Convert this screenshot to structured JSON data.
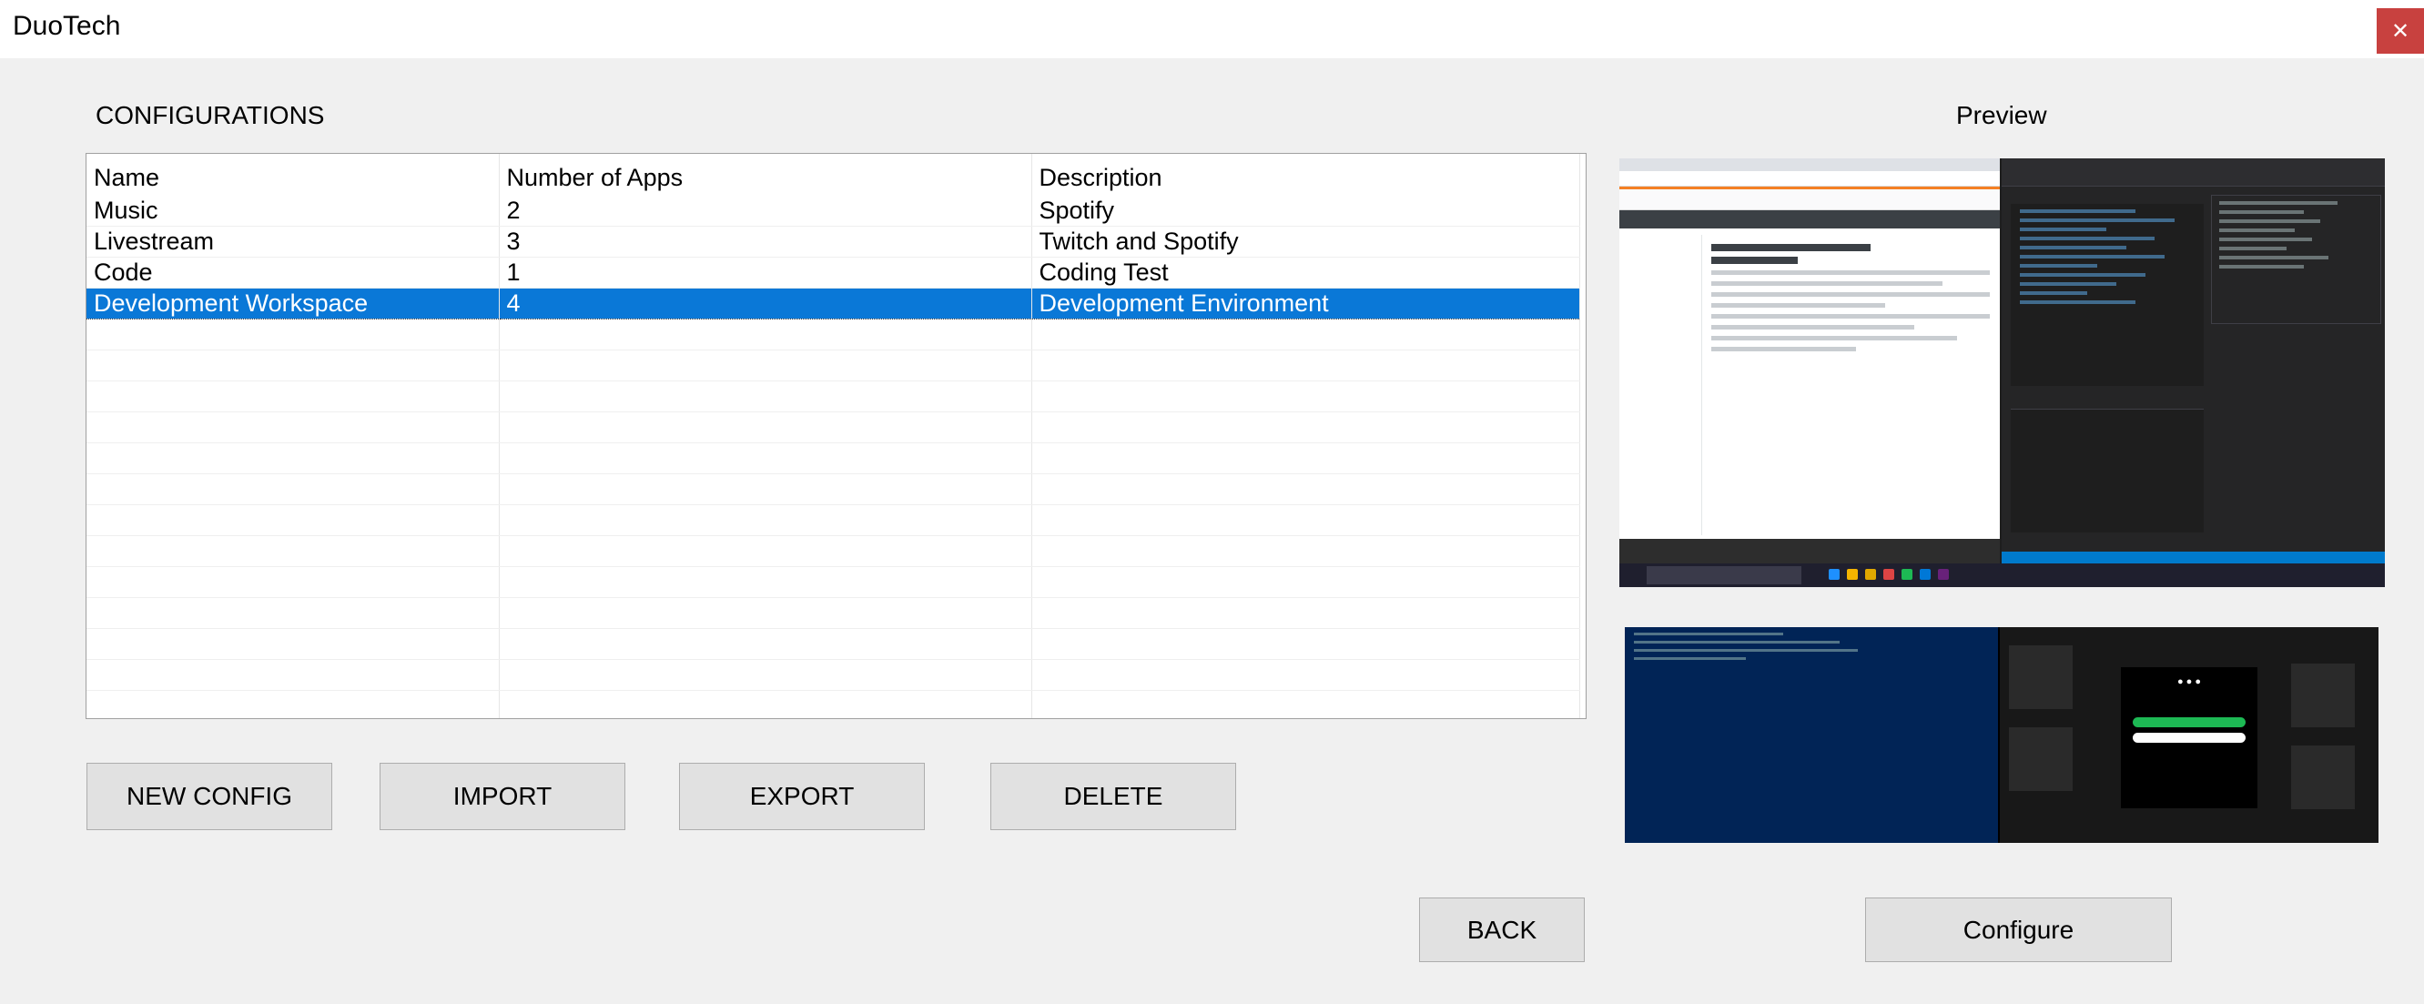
{
  "window": {
    "title": "DuoTech",
    "close_label": "✕"
  },
  "configurations": {
    "heading": "CONFIGURATIONS",
    "columns": [
      "Name",
      "Number of Apps",
      "Description"
    ],
    "rows": [
      {
        "name": "Music",
        "apps": "2",
        "description": "Spotify"
      },
      {
        "name": "Livestream",
        "apps": "3",
        "description": "Twitch and Spotify"
      },
      {
        "name": "Code",
        "apps": "1",
        "description": "Coding Test"
      },
      {
        "name": "Development Workspace",
        "apps": "4",
        "description": "Development Environment"
      }
    ],
    "selected_row": 3
  },
  "preview": {
    "heading": "Preview"
  },
  "buttons": {
    "new_config": "NEW CONFIG",
    "import": "IMPORT",
    "export": "EXPORT",
    "delete": "DELETE",
    "back": "BACK",
    "configure": "Configure"
  },
  "colors": {
    "selection": "#0a78d7",
    "close_button": "#c8413f",
    "background": "#f0f0f0"
  }
}
